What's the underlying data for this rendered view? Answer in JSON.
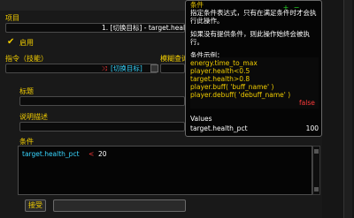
{
  "fields": {
    "item_label": "项目",
    "item_value": "1. [切换目标] - target.heal",
    "enabled_label": "启用",
    "command_label": "指令（技能）",
    "command_value": "[切换目标]",
    "fuzzy_label": "模糊查询",
    "title_label": "标题",
    "description_label": "说明描述",
    "condition_label": "条件"
  },
  "editor": {
    "code_token_1": "target.health_pct",
    "code_token_2": "<",
    "code_token_3": "20"
  },
  "tooltip": {
    "title": "条件",
    "line1": "指定条件表达式，只有在满足条件时才会执",
    "line2": "行此操作。",
    "line3": "如果没有提供条件，则此操作始终会被执",
    "line4": "行。",
    "examples_label": "条件示例：",
    "examples": [
      "energy.time_to_max",
      "player.health<0.5",
      "target.health>0.8",
      "player.buff( 'buff_name' )",
      "player.debuff( 'debuff_name' )"
    ],
    "false_label": "false",
    "values_label": "Values",
    "values_key": "target.health_pct",
    "values_num": "100"
  },
  "buttons": {
    "accept_label": "接受"
  },
  "colors": {
    "label_yellow": "#f2cd00",
    "code_cyan": "#38d6ff",
    "code_red": "#ff3b3b",
    "code_white": "#ffffff"
  },
  "icons": {
    "check": "checkmark-icon",
    "command_icon": "swap-icon"
  }
}
